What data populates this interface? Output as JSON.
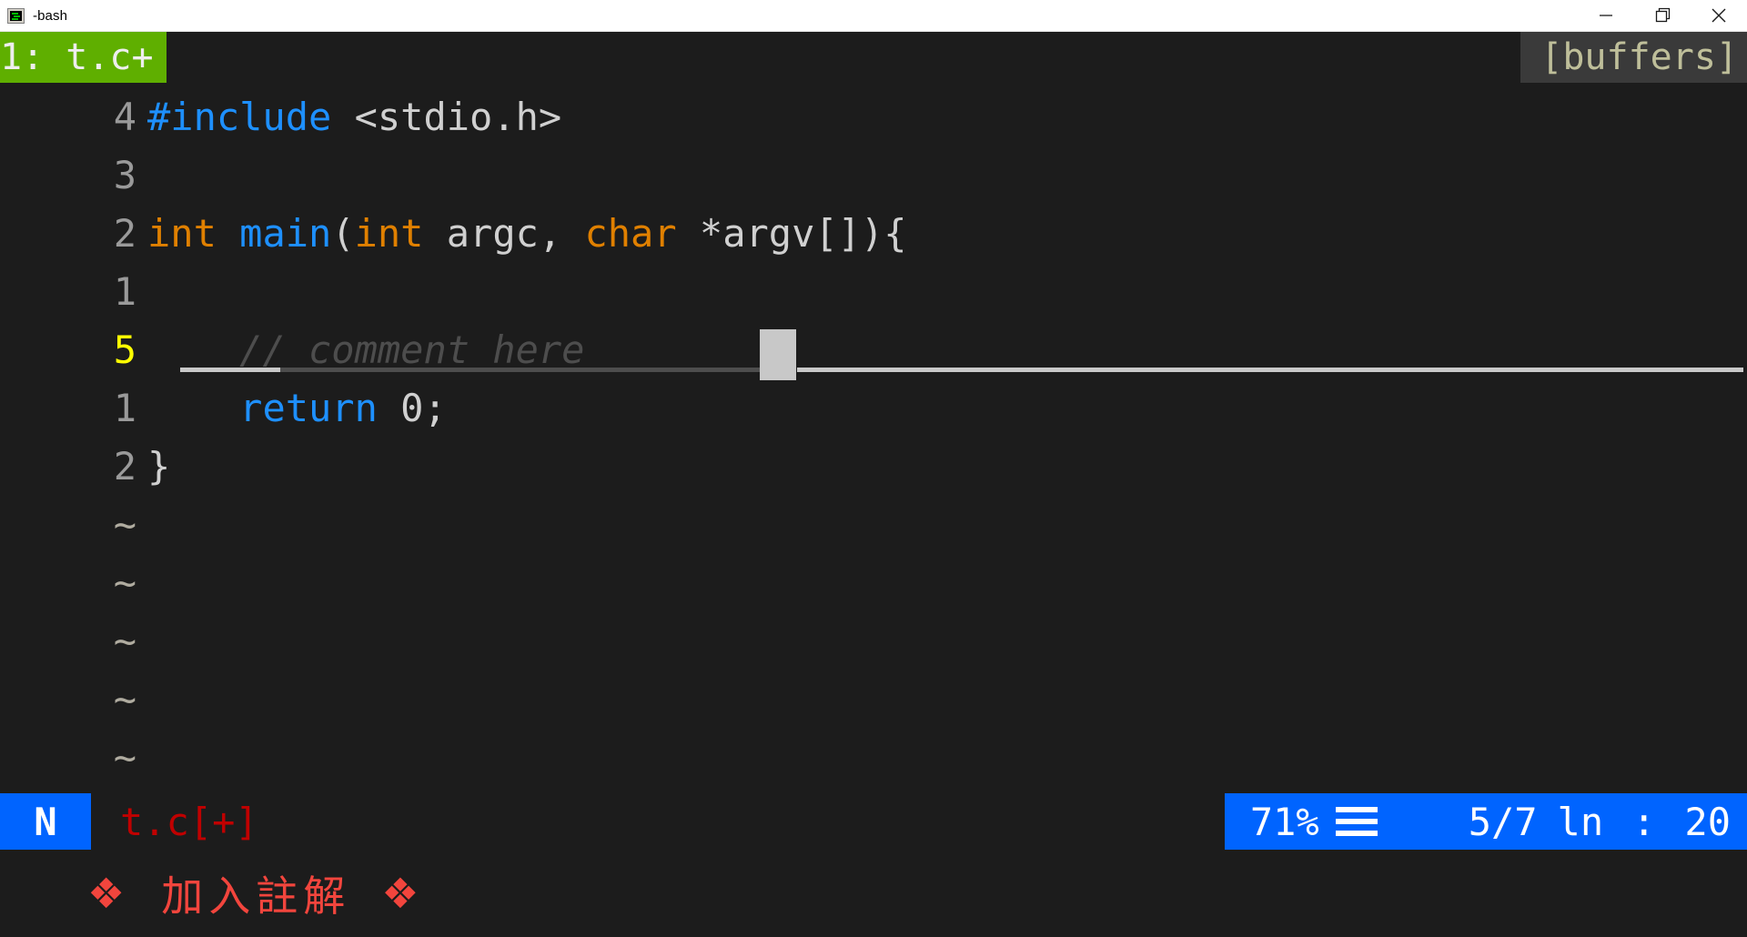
{
  "window": {
    "title": "-bash",
    "icon": "terminal-icon",
    "controls": {
      "minimize": "—",
      "maximize": "❐",
      "close": "✕"
    }
  },
  "tabline": {
    "active_tab": "1: t.c+",
    "buffers_label": "[buffers]",
    "active_tab_bg": "#5faf00",
    "buffers_bg": "#3a3a3a",
    "buffers_fg": "#bfbf9a"
  },
  "editor": {
    "background": "#1c1c1c",
    "lines": [
      {
        "num": "4",
        "current": false,
        "tokens": [
          {
            "t": "#include",
            "c": "k-pre"
          },
          {
            "t": " <stdio.h>",
            "c": "k-plain"
          }
        ]
      },
      {
        "num": "3",
        "current": false,
        "tokens": []
      },
      {
        "num": "2",
        "current": false,
        "tokens": [
          {
            "t": "int",
            "c": "k-type"
          },
          {
            "t": " ",
            "c": "k-plain"
          },
          {
            "t": "main",
            "c": "k-fn"
          },
          {
            "t": "(",
            "c": "k-plain"
          },
          {
            "t": "int",
            "c": "k-type"
          },
          {
            "t": " argc, ",
            "c": "k-plain"
          },
          {
            "t": "char",
            "c": "k-type"
          },
          {
            "t": " *argv[]){",
            "c": "k-plain"
          }
        ]
      },
      {
        "num": "1",
        "current": false,
        "tokens": []
      },
      {
        "num": "5",
        "current": true,
        "tokens": [
          {
            "t": "    ",
            "c": "k-plain"
          },
          {
            "t": "// comment here",
            "c": "k-cmt"
          }
        ]
      },
      {
        "num": "1",
        "current": false,
        "tokens": [
          {
            "t": "    ",
            "c": "k-plain"
          },
          {
            "t": "return",
            "c": "k-kw"
          },
          {
            "t": " 0;",
            "c": "k-plain"
          }
        ]
      },
      {
        "num": "2",
        "current": false,
        "tokens": [
          {
            "t": "}",
            "c": "k-plain"
          }
        ]
      }
    ],
    "empty_markers": [
      "~",
      "~",
      "~",
      "~",
      "~"
    ],
    "cursor_glyph": ""
  },
  "statusline": {
    "mode": "N",
    "mode_bg": "#0064ff",
    "filename": "t.c[+]",
    "filename_fg": "#c00000",
    "percent": "71%",
    "list_icon": "hamburger-icon",
    "position": "5/7",
    "line_label": "ln",
    "colon": ":",
    "column": "20",
    "right_bg": "#0064ff"
  },
  "caption": {
    "left_ornament": "❖",
    "text": "加入註解",
    "right_ornament": "❖",
    "color": "#f2453d"
  }
}
